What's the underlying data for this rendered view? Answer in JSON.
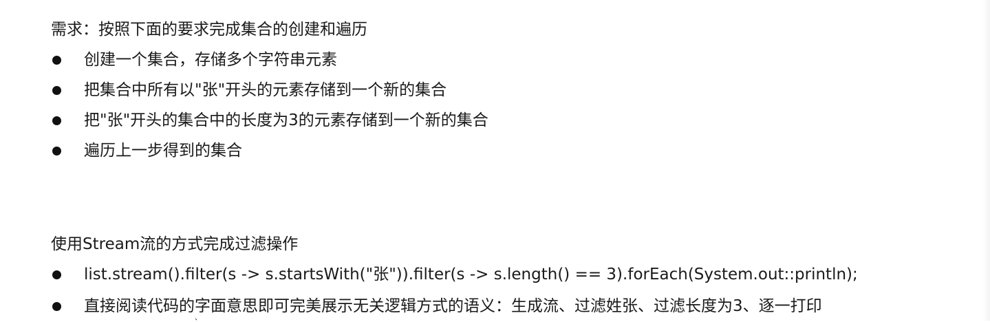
{
  "section1": {
    "heading": "需求：按照下面的要求完成集合的创建和遍历",
    "bullets": [
      "创建一个集合，存储多个字符串元素",
      "把集合中所有以\"张\"开头的元素存储到一个新的集合",
      "把\"张\"开头的集合中的长度为3的元素存储到一个新的集合",
      "遍历上一步得到的集合"
    ]
  },
  "section2": {
    "heading": "使用Stream流的方式完成过滤操作",
    "bullets": [
      "list.stream().filter(s -> s.startsWith(\"张\")).filter(s -> s.length() == 3).forEach(System.out::println);",
      "直接阅读代码的字面意思即可完美展示无关逻辑方式的语义：生成流、过滤姓张、过滤长度为3、逐一打印"
    ]
  }
}
